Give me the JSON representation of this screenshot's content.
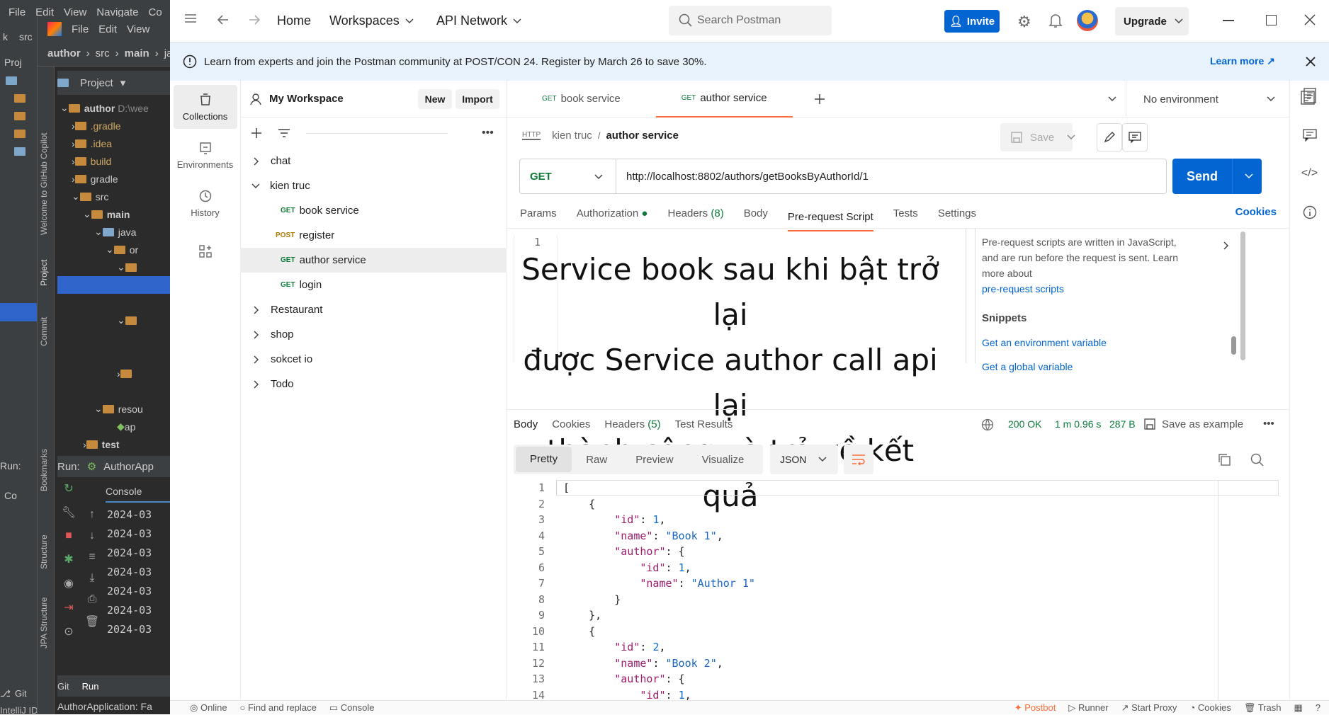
{
  "ide": {
    "menu": [
      "File",
      "Edit",
      "View",
      "Navigate",
      "Co"
    ],
    "menu2": [
      "File",
      "Edit",
      "View"
    ],
    "breadcrumb": [
      "author",
      "src",
      "main",
      "java"
    ],
    "project_label": "Project",
    "src_label": "src",
    "proj_short": "Proj",
    "tree": [
      "author",
      "D:\\wee",
      ".gradle",
      ".idea",
      "build",
      "gradle",
      "src",
      "main",
      "java",
      "or",
      "resou",
      "ap",
      "test"
    ],
    "side_tabs": [
      "Welcome to GitHub Copilot",
      "Project",
      "Commit",
      "Bookmarks",
      "Structure",
      "JPA Structure"
    ],
    "run_label": "Run:",
    "run_app": "AuthorApp",
    "console_tab": "Console",
    "console_lines": [
      "2024-03",
      "2024-03",
      "2024-03",
      "2024-03",
      "2024-03",
      "2024-03",
      "2024-03"
    ],
    "bottom_tabs": [
      "Git",
      "Run"
    ],
    "status_app": "AuthorApplication: Fa",
    "trial_text": "IntelliJ IDEA trial has expired: Buy a",
    "git_label": "Git",
    "co_label": "Co"
  },
  "postman": {
    "nav": {
      "home": "Home",
      "workspaces": "Workspaces",
      "api_network": "API Network"
    },
    "search_placeholder": "Search Postman",
    "invite": "Invite",
    "upgrade": "Upgrade",
    "banner": {
      "text": "Learn from experts and join the Postman community at POST/CON 24. Register by March 26 to save 30%.",
      "link": "Learn more ↗"
    },
    "workspace": {
      "name": "My Workspace",
      "new_btn": "New",
      "import_btn": "Import"
    },
    "rail": [
      "Collections",
      "Environments",
      "History"
    ],
    "collections": [
      {
        "name": "chat",
        "expanded": false
      },
      {
        "name": "kien truc",
        "expanded": true,
        "requests": [
          {
            "method": "GET",
            "name": "book service"
          },
          {
            "method": "POST",
            "name": "register"
          },
          {
            "method": "GET",
            "name": "author service"
          },
          {
            "method": "GET",
            "name": "login"
          }
        ]
      },
      {
        "name": "Restaurant",
        "expanded": false
      },
      {
        "name": "shop",
        "expanded": false
      },
      {
        "name": "sokcet io",
        "expanded": false
      },
      {
        "name": "Todo",
        "expanded": false
      }
    ],
    "tabs": [
      {
        "method": "GET",
        "name": "book service",
        "active": false
      },
      {
        "method": "GET",
        "name": "author service",
        "active": true
      }
    ],
    "environment": "No environment",
    "request": {
      "collection": "kien truc",
      "name": "author service",
      "save": "Save",
      "method": "GET",
      "url": "http://localhost:8802/authors/getBooksByAuthorId/1",
      "send": "Send"
    },
    "req_tabs": {
      "params": "Params",
      "authorization": "Authorization",
      "headers": "Headers",
      "headers_count": "(8)",
      "body": "Body",
      "prerequest": "Pre-request Script",
      "tests": "Tests",
      "settings": "Settings",
      "cookies": "Cookies"
    },
    "script": {
      "line": "1",
      "overlay": [
        "Service book sau khi bật trở lại",
        "được Service author call api lại",
        "thành công và trả về kết quả"
      ]
    },
    "help": {
      "text": "Pre-request scripts are written in JavaScript, and are run before the request is sent. Learn more about",
      "link": "pre-request scripts",
      "snippets_title": "Snippets",
      "snippets": [
        "Get an environment variable",
        "Get a global variable"
      ]
    },
    "response": {
      "tabs": {
        "body": "Body",
        "cookies": "Cookies",
        "headers": "Headers",
        "headers_count": "(5)",
        "test_results": "Test Results"
      },
      "status": "200 OK",
      "time": "1 m 0.96 s",
      "size": "287 B",
      "save_example": "Save as example",
      "views": [
        "Pretty",
        "Raw",
        "Preview",
        "Visualize"
      ],
      "format": "JSON"
    },
    "json_lines": [
      {
        "n": "1",
        "t": "["
      },
      {
        "n": "2",
        "t": "    {"
      },
      {
        "n": "3",
        "t": "        \"id\": 1,"
      },
      {
        "n": "4",
        "t": "        \"name\": \"Book 1\","
      },
      {
        "n": "5",
        "t": "        \"author\": {"
      },
      {
        "n": "6",
        "t": "            \"id\": 1,"
      },
      {
        "n": "7",
        "t": "            \"name\": \"Author 1\""
      },
      {
        "n": "8",
        "t": "        }"
      },
      {
        "n": "9",
        "t": "    },"
      },
      {
        "n": "10",
        "t": "    {"
      },
      {
        "n": "11",
        "t": "        \"id\": 2,"
      },
      {
        "n": "12",
        "t": "        \"name\": \"Book 2\","
      },
      {
        "n": "13",
        "t": "        \"author\": {"
      },
      {
        "n": "14",
        "t": "            \"id\": 1,"
      }
    ],
    "statusbar": [
      "Online",
      "Find and replace",
      "Console",
      "Postbot",
      "Runner",
      "Start Proxy",
      "Cookies",
      "Trash"
    ],
    "colors": {
      "accent": "#ff6c37",
      "send": "#0265d2",
      "status_ok": "#0c7b39"
    }
  }
}
